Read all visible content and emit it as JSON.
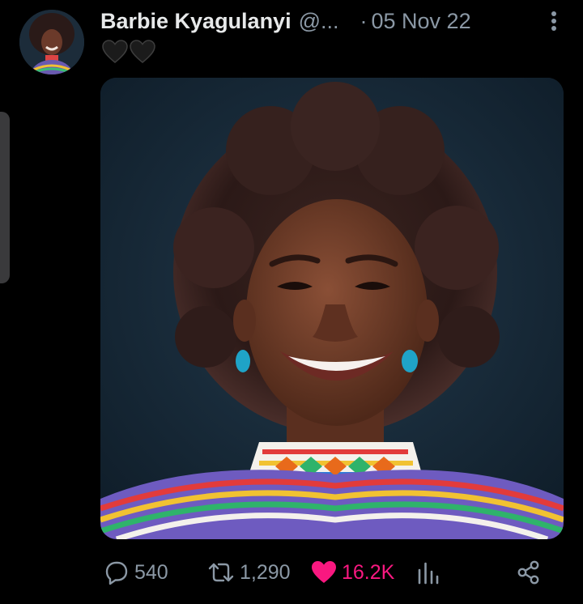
{
  "tweet": {
    "display_name": "Barbie Kyagulanyi",
    "handle": "@...",
    "separator": "·",
    "date": "05 Nov 22",
    "text_emojis": [
      "black-heart",
      "black-heart"
    ]
  },
  "actions": {
    "reply_count": "540",
    "retweet_count": "1,290",
    "like_count": "16.2K",
    "liked": true
  },
  "colors": {
    "background": "#000000",
    "text_primary": "#e7e9ea",
    "text_secondary": "#8b98a5",
    "like_active": "#f91880",
    "photo_background": "#1a2d3d"
  },
  "icons": {
    "more": "more-vertical-icon",
    "reply": "reply-icon",
    "retweet": "retweet-icon",
    "like": "heart-filled-icon",
    "views": "bar-chart-icon",
    "share": "share-icon"
  }
}
